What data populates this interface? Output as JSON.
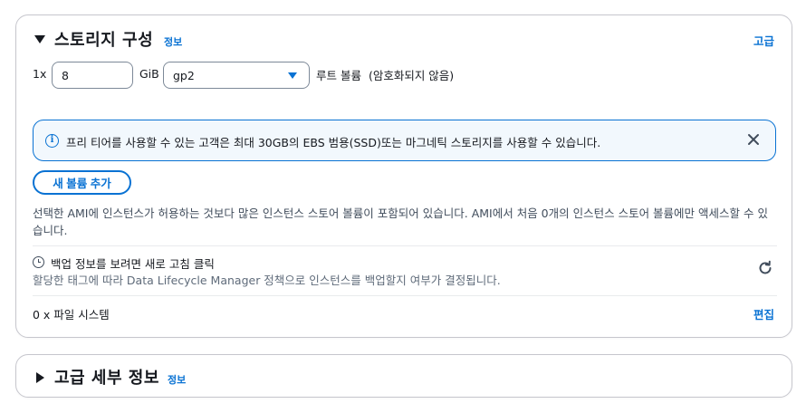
{
  "storage": {
    "title": "스토리지 구성",
    "info_label": "정보",
    "advanced_link": "고급",
    "volume": {
      "multiplier": "1x",
      "size_value": "8",
      "unit": "GiB",
      "volume_type": "gp2",
      "root_label": "루트 볼륨",
      "encryption": "(암호화되지 않음)"
    },
    "alert": {
      "text": "프리 티어를 사용할 수 있는 고객은 최대 30GB의 EBS 범용(SSD)또는 마그네틱 스토리지를 사용할 수 있습니다."
    },
    "add_volume_button": "새 볼륨 추가",
    "description": "선택한 AMI에 인스턴스가 허용하는 것보다 많은 인스턴스 스토어 볼륨이 포함되어 있습니다. AMI에서 처음 0개의 인스턴스 스토어 볼륨에만 액세스할 수 있습니다.",
    "backup": {
      "title": "백업 정보를 보려면 새로 고침 클릭",
      "subtitle": "할당한 태그에 따라 Data Lifecycle Manager 정책으로 인스턴스를 백업할지 여부가 결정됩니다."
    },
    "filesystems": {
      "label": "0 x 파일 시스템",
      "edit_link": "편집"
    }
  },
  "advanced": {
    "title": "고급 세부 정보",
    "info_label": "정보"
  },
  "colors": {
    "link": "#0972d3",
    "alert_bg": "#f2f8fd",
    "border": "#c6c6cd",
    "text": "#16191f",
    "muted_text": "#414d5c"
  },
  "icons": {
    "caret_expanded": "caret-down-icon",
    "caret_collapsed": "caret-right-icon",
    "info": "info-circle-icon",
    "close": "close-icon",
    "clock": "clock-icon",
    "refresh": "refresh-icon",
    "dropdown": "dropdown-arrow-icon"
  }
}
